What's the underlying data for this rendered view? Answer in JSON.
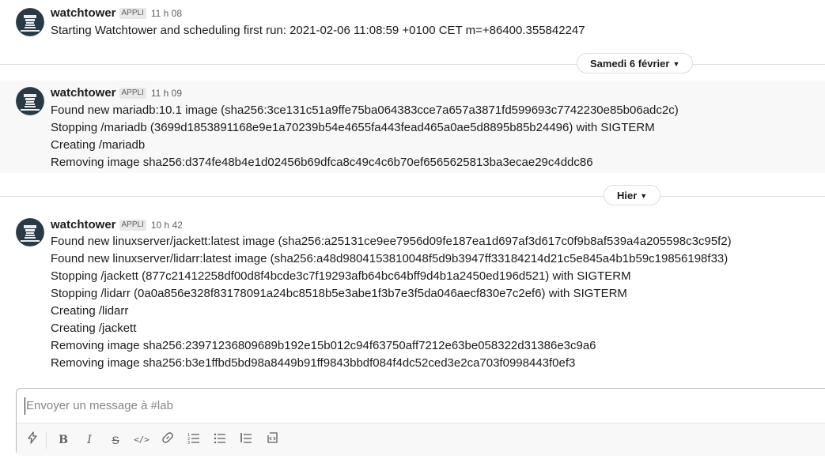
{
  "app_badge": "APPLI",
  "messages": [
    {
      "sender": "watchtower",
      "time": "11 h 08",
      "lines": [
        "Starting Watchtower and scheduling first run: 2021-02-06 11:08:59 +0100 CET m=+86400.355842247"
      ]
    },
    {
      "sender": "watchtower",
      "time": "11 h 09",
      "lines": [
        "Found new mariadb:10.1 image (sha256:3ce131c51a9ffe75ba064383cce7a657a3871fd599693c7742230e85b06adc2c)",
        "Stopping /mariadb (3699d1853891168e9e1a70239b54e4655fa443fead465a0ae5d8895b85b24496) with SIGTERM",
        "Creating /mariadb",
        "Removing image sha256:d374fe48b4e1d02456b69dfca8c49c4c6b70ef6565625813ba3ecae29c4ddc86"
      ]
    },
    {
      "sender": "watchtower",
      "time": "10 h 42",
      "lines": [
        "Found new linuxserver/jackett:latest image (sha256:a25131ce9ee7956d09fe187ea1d697af3d617c0f9b8af539a4a205598c3c95f2)",
        "Found new linuxserver/lidarr:latest image (sha256:a48d9804153810048f5d9b3947ff33184214d21c5e845a4b1b59c19856198f33)",
        "Stopping /jackett (877c21412258df00d8f4bcde3c7f19293afb64bc64bff9d4b1a2450ed196d521) with SIGTERM",
        "Stopping /lidarr (0a0a856e328f83178091a24bc8518b5e3abe1f3b7e3f5da046aecf830e7c2ef6) with SIGTERM",
        "Creating /lidarr",
        "Creating /jackett",
        "Removing image sha256:23971236809689b192e15b012c94f63750aff7212e63be058322d31386e3c9a6",
        "Removing image sha256:b3e1ffbd5bd98a8449b91ff9843bbdf084f4dc52ced3e2ca703f0998443f0ef3"
      ]
    }
  ],
  "date_dividers": [
    "Samedi 6 février",
    "Hier"
  ],
  "composer": {
    "placeholder": "Envoyer un message à #lab"
  },
  "toolbar_icons": [
    "lightning-icon",
    "bold-icon",
    "italic-icon",
    "strikethrough-icon",
    "code-icon",
    "link-icon",
    "ordered-list-icon",
    "bullet-list-icon",
    "blockquote-icon",
    "code-block-icon"
  ],
  "colors": {
    "avatar_bg": "#2a3a44",
    "divider": "#dddddd",
    "hover_bg": "#f8f8f8"
  }
}
